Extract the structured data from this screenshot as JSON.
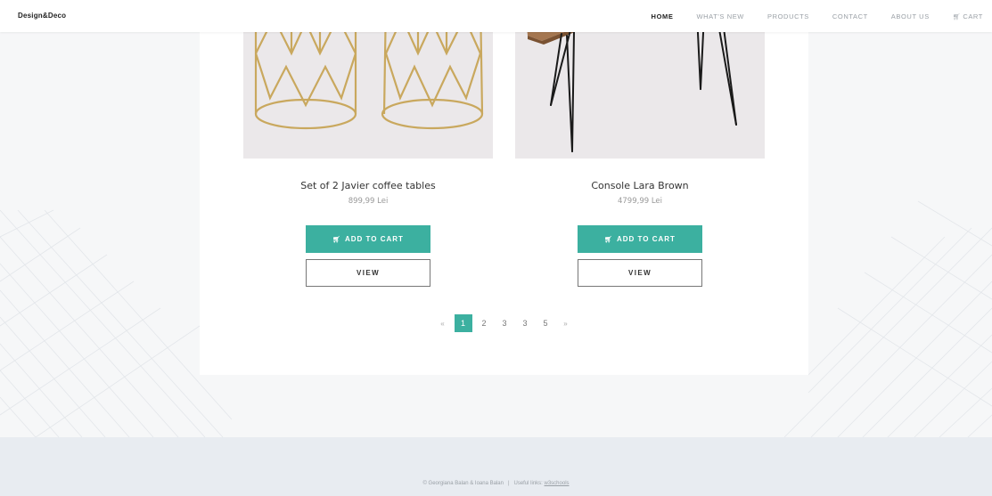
{
  "brand": "Design&Deco",
  "nav": {
    "items": [
      "HOME",
      "WHAT'S NEW",
      "PRODUCTS",
      "CONTACT",
      "ABOUT US",
      "CART"
    ],
    "active": "HOME",
    "cart_icon": "cart-icon"
  },
  "products": [
    {
      "name": "Set of 2 Javier coffee tables",
      "price": "899,99 Lei",
      "add_label": "ADD TO CART",
      "view_label": "VIEW"
    },
    {
      "name": "Console Lara Brown",
      "price": "4799,99 Lei",
      "add_label": "ADD TO CART",
      "view_label": "VIEW"
    }
  ],
  "pagination": {
    "prev": "«",
    "pages": [
      "1",
      "2",
      "3",
      "3",
      "5"
    ],
    "next": "»",
    "active_page": "1"
  },
  "footer": {
    "copyright": "© Georgiana Balan & Ioana Balan",
    "separator": "|",
    "useful_label": "Useful links:",
    "link_text": "w3schools"
  },
  "colors": {
    "accent": "#3cb0a0",
    "footer_bg": "#e8ecf1",
    "page_bg": "#f6f7f8"
  }
}
